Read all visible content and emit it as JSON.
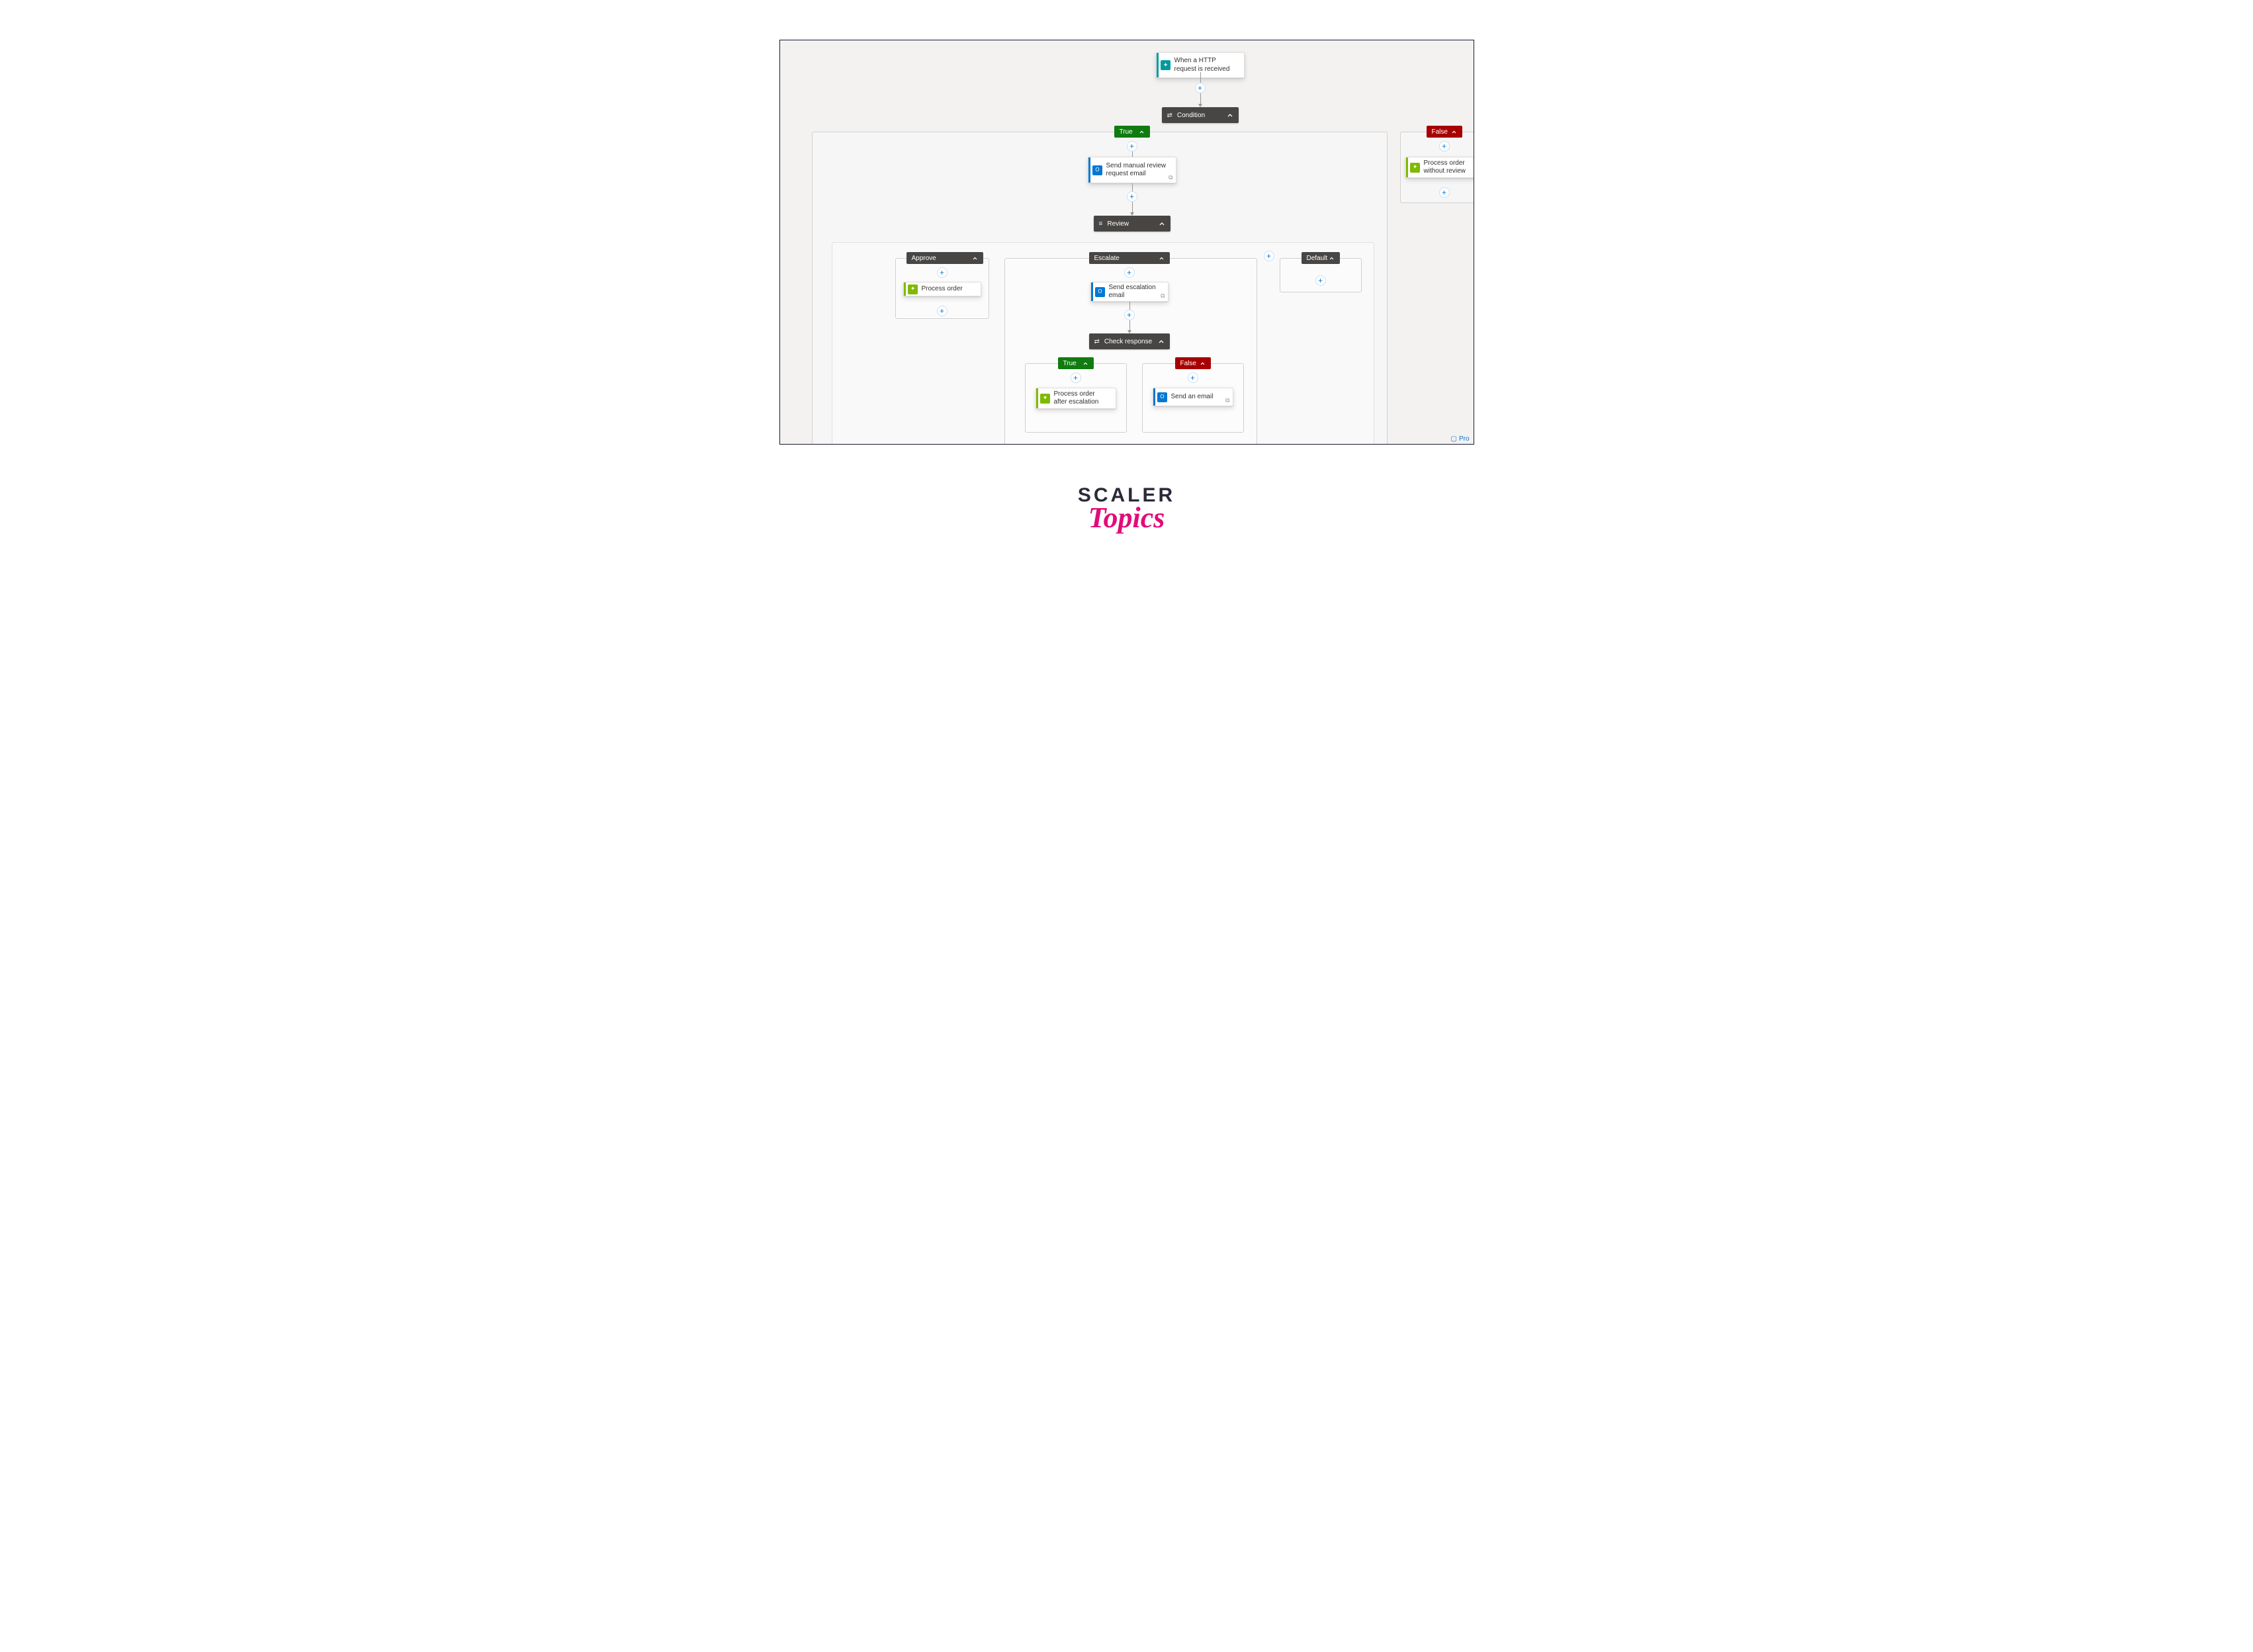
{
  "canvas": {
    "trigger": {
      "label": "When a HTTP request is received"
    },
    "condition": {
      "label": "Condition"
    },
    "trueBranch": {
      "pill": "True",
      "action1": {
        "label": "Send manual review request email"
      },
      "review": {
        "label": "Review"
      },
      "approve": {
        "pill": "Approve",
        "action": {
          "label": "Process order"
        }
      },
      "escalate": {
        "pill": "Escalate",
        "action": {
          "label": "Send escalation email"
        },
        "check": {
          "label": "Check response"
        },
        "checkTrue": {
          "pill": "True",
          "action": {
            "label": "Process order after escalation"
          }
        },
        "checkFalse": {
          "pill": "False",
          "action": {
            "label": "Send an email"
          }
        }
      },
      "default": {
        "pill": "Default"
      }
    },
    "falseBranch": {
      "pill": "False",
      "action": {
        "label": "Process order without review"
      }
    },
    "footer": "Pro"
  },
  "brand": {
    "line1": "SCALER",
    "line2": "Topics"
  }
}
